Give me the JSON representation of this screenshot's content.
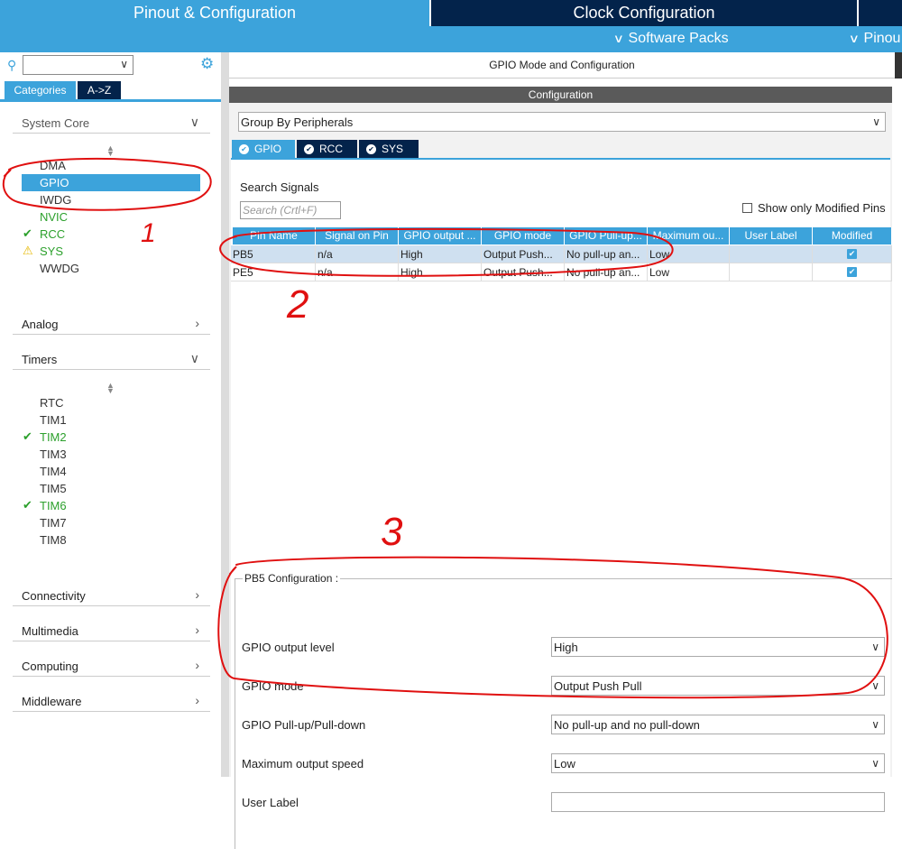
{
  "top_tabs": {
    "pinout": "Pinout & Configuration",
    "clock": "Clock Configuration"
  },
  "subbar": {
    "software_packs": "Software Packs",
    "pinout": "Pinou"
  },
  "left": {
    "categories_tab": "Categories",
    "az_tab": "A->Z",
    "system_core": {
      "label": "System Core",
      "items": [
        {
          "label": "DMA",
          "status": "none"
        },
        {
          "label": "GPIO",
          "status": "selected"
        },
        {
          "label": "IWDG",
          "status": "none"
        },
        {
          "label": "NVIC",
          "status": "green"
        },
        {
          "label": "RCC",
          "status": "check"
        },
        {
          "label": "SYS",
          "status": "warning"
        },
        {
          "label": "WWDG",
          "status": "none"
        }
      ]
    },
    "analog": "Analog",
    "timers": {
      "label": "Timers",
      "items": [
        {
          "label": "RTC",
          "status": "none"
        },
        {
          "label": "TIM1",
          "status": "none"
        },
        {
          "label": "TIM2",
          "status": "check"
        },
        {
          "label": "TIM3",
          "status": "none"
        },
        {
          "label": "TIM4",
          "status": "none"
        },
        {
          "label": "TIM5",
          "status": "none"
        },
        {
          "label": "TIM6",
          "status": "check"
        },
        {
          "label": "TIM7",
          "status": "none"
        },
        {
          "label": "TIM8",
          "status": "none"
        }
      ]
    },
    "connectivity": "Connectivity",
    "multimedia": "Multimedia",
    "computing": "Computing",
    "middleware": "Middleware"
  },
  "right": {
    "mode_title": "GPIO Mode and Configuration",
    "config_header": "Configuration",
    "group_by": "Group By Peripherals",
    "tabs": [
      "GPIO",
      "RCC",
      "SYS"
    ],
    "search_signals_label": "Search Signals",
    "search_placeholder": "Search (Crtl+F)",
    "show_modified": "Show only Modified Pins",
    "columns": [
      "Pin Name",
      "Signal on Pin",
      "GPIO output ...",
      "GPIO mode",
      "GPIO Pull-up...",
      "Maximum ou...",
      "User Label",
      "Modified"
    ],
    "rows": [
      {
        "pin": "PB5",
        "signal": "n/a",
        "output": "High",
        "mode": "Output Push...",
        "pull": "No pull-up an...",
        "speed": "Low",
        "label": "",
        "modified": true
      },
      {
        "pin": "PE5",
        "signal": "n/a",
        "output": "High",
        "mode": "Output Push...",
        "pull": "No pull-up an...",
        "speed": "Low",
        "label": "",
        "modified": true
      }
    ],
    "pb5_config_title": "PB5 Configuration :",
    "fields": [
      {
        "label": "GPIO output level",
        "value": "High"
      },
      {
        "label": "GPIO mode",
        "value": "Output Push Pull"
      },
      {
        "label": "GPIO Pull-up/Pull-down",
        "value": "No pull-up and no pull-down"
      },
      {
        "label": "Maximum output speed",
        "value": "Low"
      },
      {
        "label": "User Label",
        "value": ""
      }
    ]
  },
  "annotations": {
    "one": "1",
    "two": "2",
    "three": "3"
  },
  "colors": {
    "accent": "#3ca3db",
    "dark": "#03234b",
    "annotation": "#e01010",
    "green": "#2ca02c"
  }
}
